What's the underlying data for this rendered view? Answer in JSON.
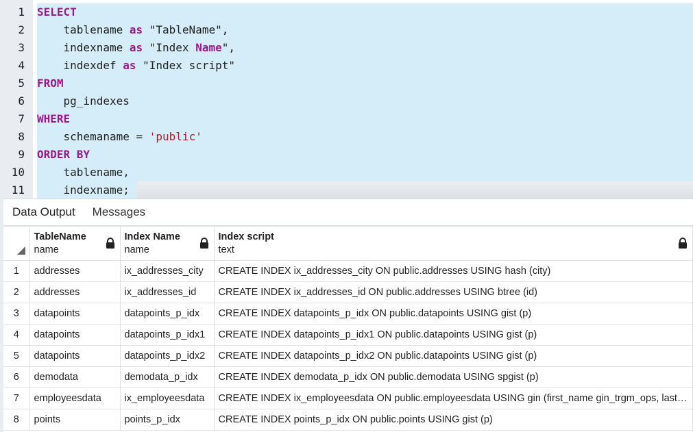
{
  "editor": {
    "lines": [
      {
        "num": "1",
        "tokens": [
          {
            "t": "SELECT",
            "c": "kw"
          }
        ]
      },
      {
        "num": "2",
        "tokens": [
          {
            "t": "    tablename ",
            "c": "plain"
          },
          {
            "t": "as",
            "c": "kw"
          },
          {
            "t": " \"TableName\",",
            "c": "plain"
          }
        ]
      },
      {
        "num": "3",
        "tokens": [
          {
            "t": "    indexname ",
            "c": "plain"
          },
          {
            "t": "as",
            "c": "kw"
          },
          {
            "t": " \"Index ",
            "c": "plain"
          },
          {
            "t": "Name",
            "c": "kw"
          },
          {
            "t": "\",",
            "c": "plain"
          }
        ]
      },
      {
        "num": "4",
        "tokens": [
          {
            "t": "    indexdef ",
            "c": "plain"
          },
          {
            "t": "as",
            "c": "kw"
          },
          {
            "t": " \"Index script\"",
            "c": "plain"
          }
        ]
      },
      {
        "num": "5",
        "tokens": [
          {
            "t": "FROM",
            "c": "kw"
          }
        ]
      },
      {
        "num": "6",
        "tokens": [
          {
            "t": "    pg_indexes",
            "c": "plain"
          }
        ]
      },
      {
        "num": "7",
        "tokens": [
          {
            "t": "WHERE",
            "c": "kw"
          }
        ]
      },
      {
        "num": "8",
        "tokens": [
          {
            "t": "    schemaname = ",
            "c": "plain"
          },
          {
            "t": "'public'",
            "c": "str"
          }
        ]
      },
      {
        "num": "9",
        "tokens": [
          {
            "t": "ORDER BY",
            "c": "kw"
          }
        ]
      },
      {
        "num": "10",
        "tokens": [
          {
            "t": "    tablename,",
            "c": "plain"
          }
        ]
      },
      {
        "num": "11",
        "tokens": [
          {
            "t": "    indexname;",
            "c": "plain"
          }
        ]
      }
    ]
  },
  "results": {
    "tabs": [
      {
        "label": "Data Output",
        "active": true
      },
      {
        "label": "Messages",
        "active": false
      }
    ],
    "columns": [
      {
        "name": "TableName",
        "type": "name",
        "locked": true
      },
      {
        "name": "Index Name",
        "type": "name",
        "locked": true
      },
      {
        "name": "Index script",
        "type": "text",
        "locked": true
      }
    ],
    "rows": [
      {
        "n": "1",
        "table": "addresses",
        "index": "ix_addresses_city",
        "script": "CREATE INDEX ix_addresses_city ON public.addresses USING hash (city)"
      },
      {
        "n": "2",
        "table": "addresses",
        "index": "ix_addresses_id",
        "script": "CREATE INDEX ix_addresses_id ON public.addresses USING btree (id)"
      },
      {
        "n": "3",
        "table": "datapoints",
        "index": "datapoints_p_idx",
        "script": "CREATE INDEX datapoints_p_idx ON public.datapoints USING gist (p)"
      },
      {
        "n": "4",
        "table": "datapoints",
        "index": "datapoints_p_idx1",
        "script": "CREATE INDEX datapoints_p_idx1 ON public.datapoints USING gist (p)"
      },
      {
        "n": "5",
        "table": "datapoints",
        "index": "datapoints_p_idx2",
        "script": "CREATE INDEX datapoints_p_idx2 ON public.datapoints USING gist (p)"
      },
      {
        "n": "6",
        "table": "demodata",
        "index": "demodata_p_idx",
        "script": "CREATE INDEX demodata_p_idx ON public.demodata USING spgist (p)"
      },
      {
        "n": "7",
        "table": "employeesdata",
        "index": "ix_employeesdata",
        "script": "CREATE INDEX ix_employeesdata ON public.employeesdata USING gin (first_name gin_trgm_ops, last_name gin_trgm_ops)"
      },
      {
        "n": "8",
        "table": "points",
        "index": "points_p_idx",
        "script": "CREATE INDEX points_p_idx ON public.points USING gist (p)"
      }
    ]
  }
}
